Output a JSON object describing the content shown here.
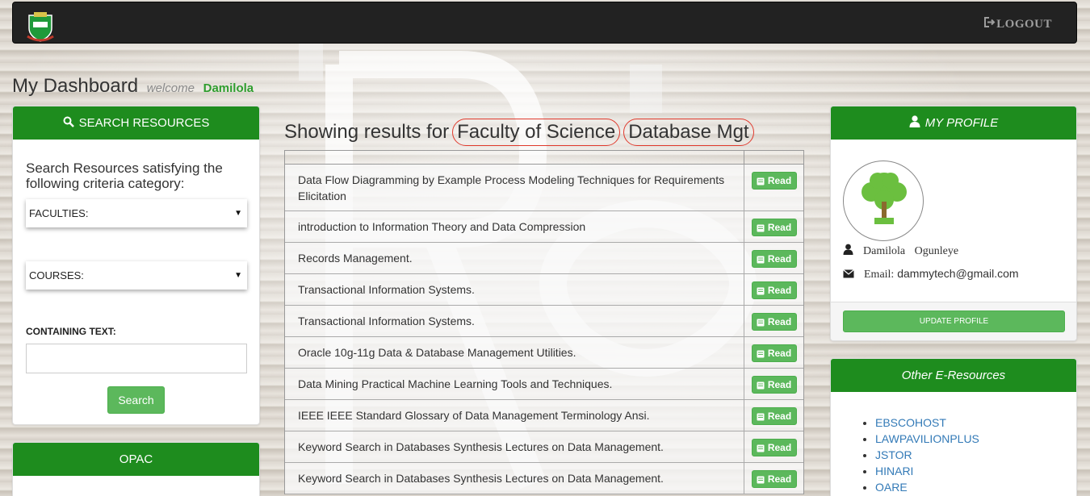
{
  "navbar": {
    "logout_label": "LOGOUT"
  },
  "dashboard": {
    "title": "My Dashboard",
    "welcome": "welcome",
    "username": "Damilola"
  },
  "search_panel": {
    "header": "SEARCH RESOURCES",
    "lead_text": "Search Resources satisfying the following criteria category:",
    "faculties_selected": "FACULTIES:",
    "courses_selected": "COURSES:",
    "containing_label": "CONTAINING TEXT:",
    "containing_value": "",
    "search_button": "Search"
  },
  "opac_panel": {
    "header": "OPAC"
  },
  "results": {
    "prefix": "Showing results for",
    "faculty_chip": "Faculty of Science",
    "course_chip": "Database Mgt",
    "read_label": "Read",
    "items": [
      "Data Flow Diagramming by Example Process Modeling Techniques for Requirements Elicitation",
      "introduction to Information Theory and Data Compression",
      "Records Management.",
      "Transactional Information Systems.",
      "Transactional Information Systems.",
      "Oracle 10g-11g Data & Database Management Utilities.",
      "Data Mining Practical Machine Learning Tools and Techniques.",
      "IEEE IEEE Standard Glossary of Data Management Terminology Ansi.",
      "Keyword Search in Databases Synthesis Lectures on Data Management.",
      "Keyword Search in Databases Synthesis Lectures on Data Management."
    ]
  },
  "profile": {
    "header": "MY PROFILE",
    "first_name": "Damilola",
    "last_name": "Ogunleye",
    "email_label": "Email:",
    "email": "dammytech@gmail.com",
    "update_button": "UPDATE PROFILE"
  },
  "e_resources": {
    "header": "Other E-Resources",
    "links": [
      "EBSCOHOST",
      "LAWPAVILIONPLUS",
      "JSTOR",
      "HINARI",
      "OARE"
    ]
  },
  "colors": {
    "brand_green": "#1e8c1e",
    "button_green": "#5cb85c",
    "navbar": "#222222",
    "chip_border": "#e0392c"
  }
}
